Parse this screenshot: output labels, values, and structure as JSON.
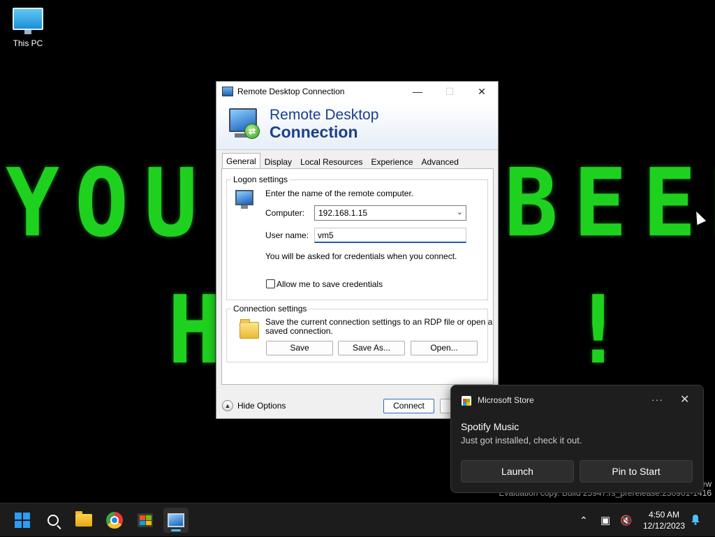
{
  "desktop": {
    "icon_label": "This PC",
    "wall_line1_left": "YOU",
    "wall_line1_right": "BEEN",
    "wall_line2_left": "H",
    "wall_line2_right": "!"
  },
  "rdp": {
    "title": "Remote Desktop Connection",
    "banner_line1": "Remote Desktop",
    "banner_line2": "Connection",
    "tabs": [
      "General",
      "Display",
      "Local Resources",
      "Experience",
      "Advanced"
    ],
    "logon": {
      "legend": "Logon settings",
      "intro": "Enter the name of the remote computer.",
      "computer_label": "Computer:",
      "computer_value": "192.168.1.15",
      "username_label": "User name:",
      "username_value": "vm5",
      "credentials_note": "You will be asked for credentials when you connect.",
      "save_credentials_label": "Allow me to save credentials"
    },
    "connection": {
      "legend": "Connection settings",
      "description_line1": "Save the current connection settings to an RDP file or open a",
      "description_line2": "saved connection.",
      "save_label": "Save",
      "save_as_label": "Save As...",
      "open_label": "Open..."
    },
    "hide_options_label": "Hide Options",
    "connect_label": "Connect"
  },
  "toast": {
    "app_name": "Microsoft Store",
    "more_glyph": "···",
    "heading": "Spotify Music",
    "body": "Just got installed, check it out.",
    "launch_label": "Launch",
    "pin_label": "Pin to Start"
  },
  "watermark": {
    "edge_text": "ew",
    "build_text": "Evaluation copy. Build 25947.rs_prerelease.230901-1416"
  },
  "taskbar": {
    "time": "4:50 AM",
    "date": "12/12/2023"
  }
}
